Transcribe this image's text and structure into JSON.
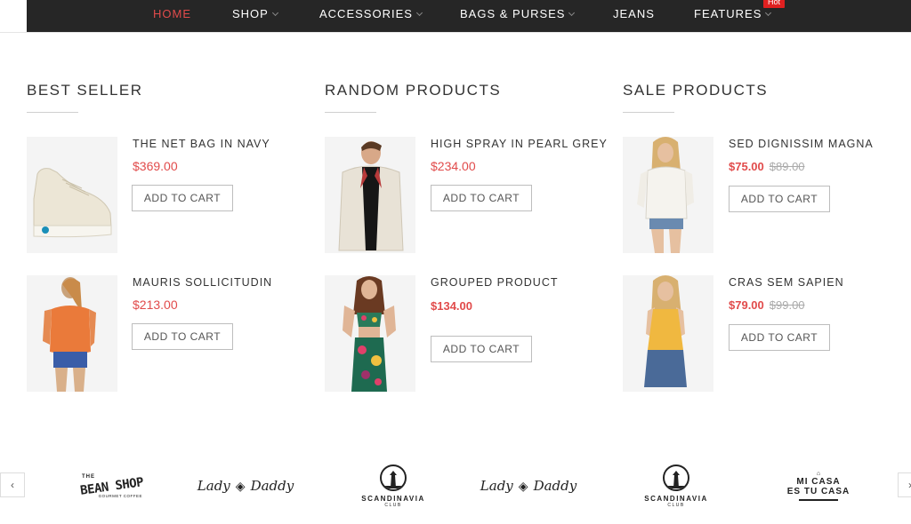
{
  "nav": {
    "items": [
      {
        "label": "HOME",
        "active": true,
        "dropdown": false
      },
      {
        "label": "SHOP",
        "active": false,
        "dropdown": true
      },
      {
        "label": "ACCESSORIES",
        "active": false,
        "dropdown": true
      },
      {
        "label": "BAGS & PURSES",
        "active": false,
        "dropdown": true
      },
      {
        "label": "JEANS",
        "active": false,
        "dropdown": false
      },
      {
        "label": "FEATURES",
        "active": false,
        "dropdown": true
      }
    ],
    "badge": "Hot"
  },
  "sections": [
    {
      "title": "BEST SELLER",
      "products": [
        {
          "name": "THE NET BAG IN NAVY",
          "price": "$369.00",
          "old_price": "",
          "cta": "ADD TO CART",
          "image_icon": "sneaker-image"
        },
        {
          "name": "MAURIS SOLLICITUDIN",
          "price": "$213.00",
          "old_price": "",
          "cta": "ADD TO CART",
          "image_icon": "orange-top-image"
        }
      ]
    },
    {
      "title": "RANDOM PRODUCTS",
      "products": [
        {
          "name": "HIGH SPRAY IN PEARL GREY",
          "price": "$234.00",
          "old_price": "",
          "cta": "ADD TO CART",
          "image_icon": "jacket-man-image"
        },
        {
          "name": "GROUPED PRODUCT",
          "price": "$134.00",
          "old_price": "",
          "cta": "ADD TO CART",
          "image_icon": "floral-set-image"
        }
      ]
    },
    {
      "title": "SALE PRODUCTS",
      "products": [
        {
          "name": "SED DIGNISSIM MAGNA",
          "price": "$75.00",
          "old_price": "$89.00",
          "cta": "ADD TO CART",
          "image_icon": "white-shirt-image"
        },
        {
          "name": "CRAS SEM SAPIEN",
          "price": "$79.00",
          "old_price": "$99.00",
          "cta": "ADD TO CART",
          "image_icon": "yellow-top-image"
        }
      ]
    }
  ],
  "brands": {
    "prev_icon": "chevron-left-icon",
    "next_icon": "chevron-right-icon",
    "logos": [
      {
        "name": "THE BEAN SHOP",
        "line1": "THE",
        "line2": "BEAN SHOP",
        "line3": "GOURMET COFFEE"
      },
      {
        "name": "Lady Daddy",
        "line1": "Lady",
        "line2": "Daddy"
      },
      {
        "name": "SCANDINAVIA CLUB",
        "line1": "SCANDINAVIA",
        "line2": "CLUB"
      },
      {
        "name": "Lady Daddy",
        "line1": "Lady",
        "line2": "Daddy"
      },
      {
        "name": "SCANDINAVIA CLUB",
        "line1": "SCANDINAVIA",
        "line2": "CLUB"
      },
      {
        "name": "MI CASA ES TU CASA",
        "line1": "MI CASA",
        "line2": "ES TU CASA"
      }
    ]
  },
  "colors": {
    "accent": "#e14b4b",
    "nav_bg": "#262626",
    "badge": "#e02020"
  }
}
